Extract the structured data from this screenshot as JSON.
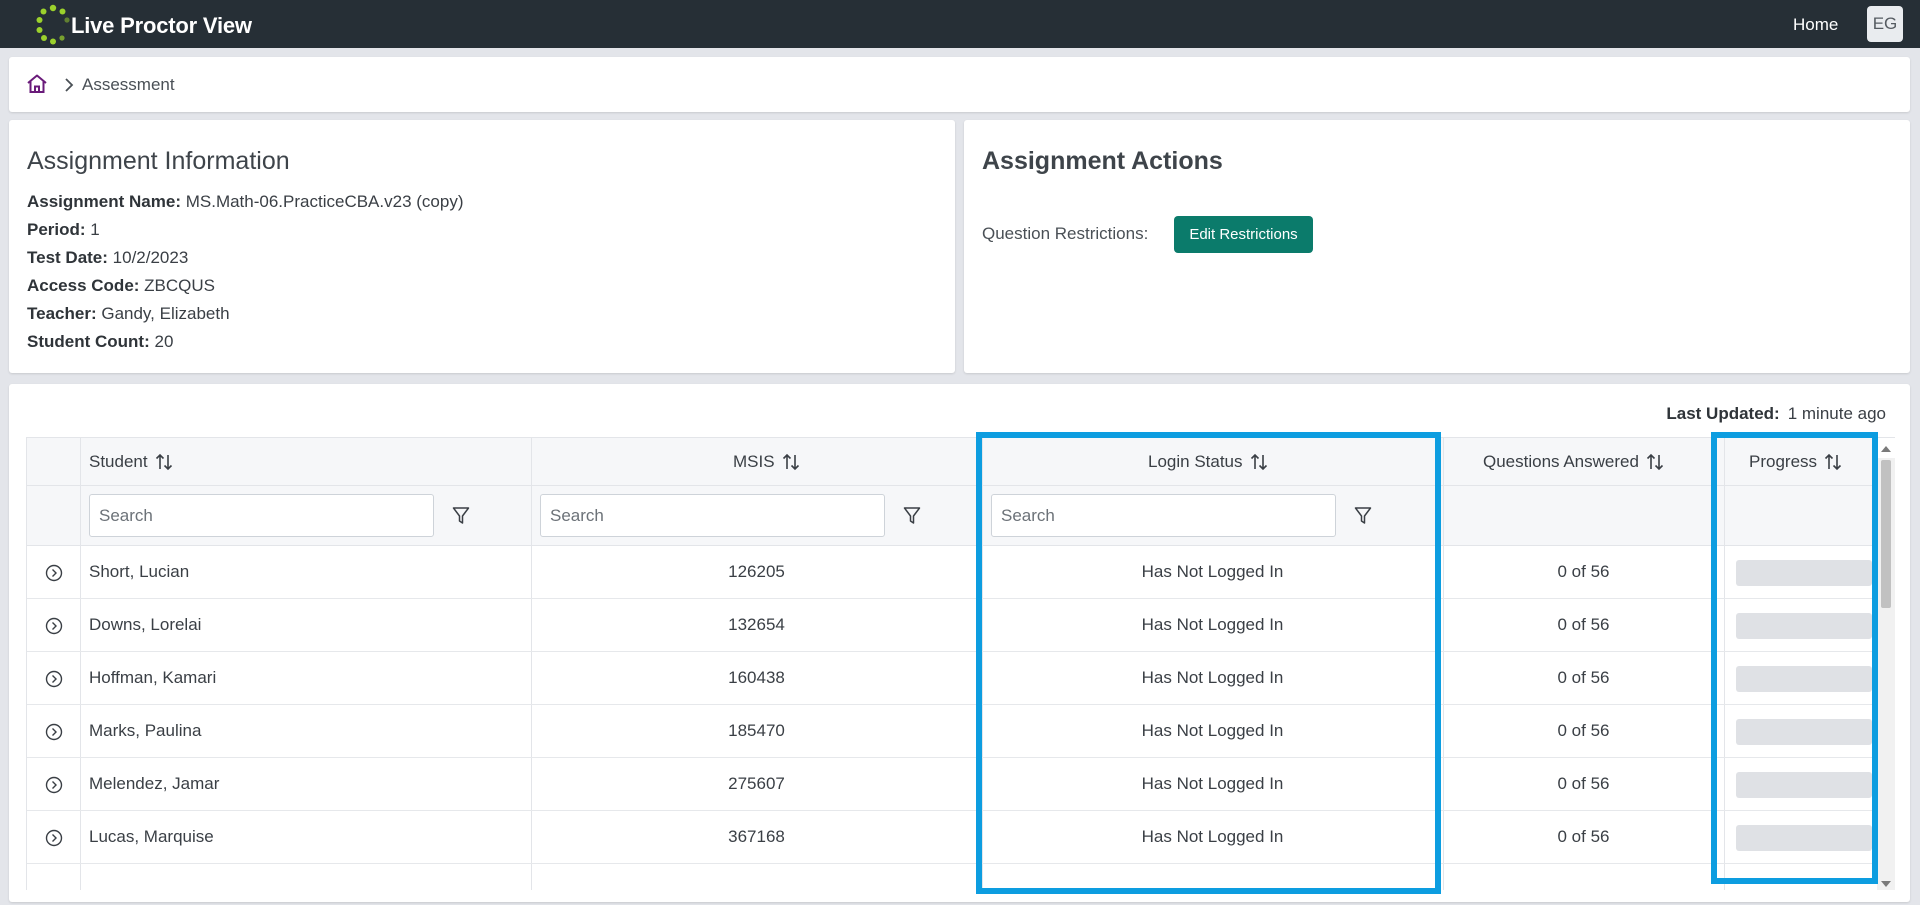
{
  "app": {
    "title": "Live Proctor View",
    "home_label": "Home",
    "user_initials": "EG"
  },
  "breadcrumb": {
    "current": "Assessment"
  },
  "assignment_info": {
    "title": "Assignment Information",
    "fields": [
      {
        "label": "Assignment Name:",
        "value": "MS.Math-06.PracticeCBA.v23 (copy)"
      },
      {
        "label": "Period:",
        "value": "1"
      },
      {
        "label": "Test Date:",
        "value": "10/2/2023"
      },
      {
        "label": "Access Code:",
        "value": "ZBCQUS"
      },
      {
        "label": "Teacher:",
        "value": "Gandy, Elizabeth"
      },
      {
        "label": "Student Count:",
        "value": "20"
      }
    ]
  },
  "assignment_actions": {
    "title": "Assignment Actions",
    "question_restrictions_label": "Question Restrictions:",
    "edit_restrictions_label": "Edit Restrictions"
  },
  "table": {
    "last_updated_label": "Last Updated:",
    "last_updated_value": "1 minute ago",
    "columns": {
      "student": "Student",
      "msis": "MSIS",
      "login_status": "Login Status",
      "questions_answered": "Questions Answered",
      "progress": "Progress"
    },
    "search_placeholder": "Search",
    "rows": [
      {
        "student": "Short, Lucian",
        "msis": "126205",
        "login_status": "Has Not Logged In",
        "questions": "0 of 56",
        "progress": 0
      },
      {
        "student": "Downs, Lorelai",
        "msis": "132654",
        "login_status": "Has Not Logged In",
        "questions": "0 of 56",
        "progress": 0
      },
      {
        "student": "Hoffman, Kamari",
        "msis": "160438",
        "login_status": "Has Not Logged In",
        "questions": "0 of 56",
        "progress": 0
      },
      {
        "student": "Marks, Paulina",
        "msis": "185470",
        "login_status": "Has Not Logged In",
        "questions": "0 of 56",
        "progress": 0
      },
      {
        "student": "Melendez, Jamar",
        "msis": "275607",
        "login_status": "Has Not Logged In",
        "questions": "0 of 56",
        "progress": 0
      },
      {
        "student": "Lucas, Marquise",
        "msis": "367168",
        "login_status": "Has Not Logged In",
        "questions": "0 of 56",
        "progress": 0
      }
    ]
  },
  "colors": {
    "topbar": "#262f36",
    "accent_button": "#0b7b6b",
    "highlight": "#0d9de0",
    "logo_green": "#9bd12c",
    "home_icon": "#6a1b7a"
  }
}
